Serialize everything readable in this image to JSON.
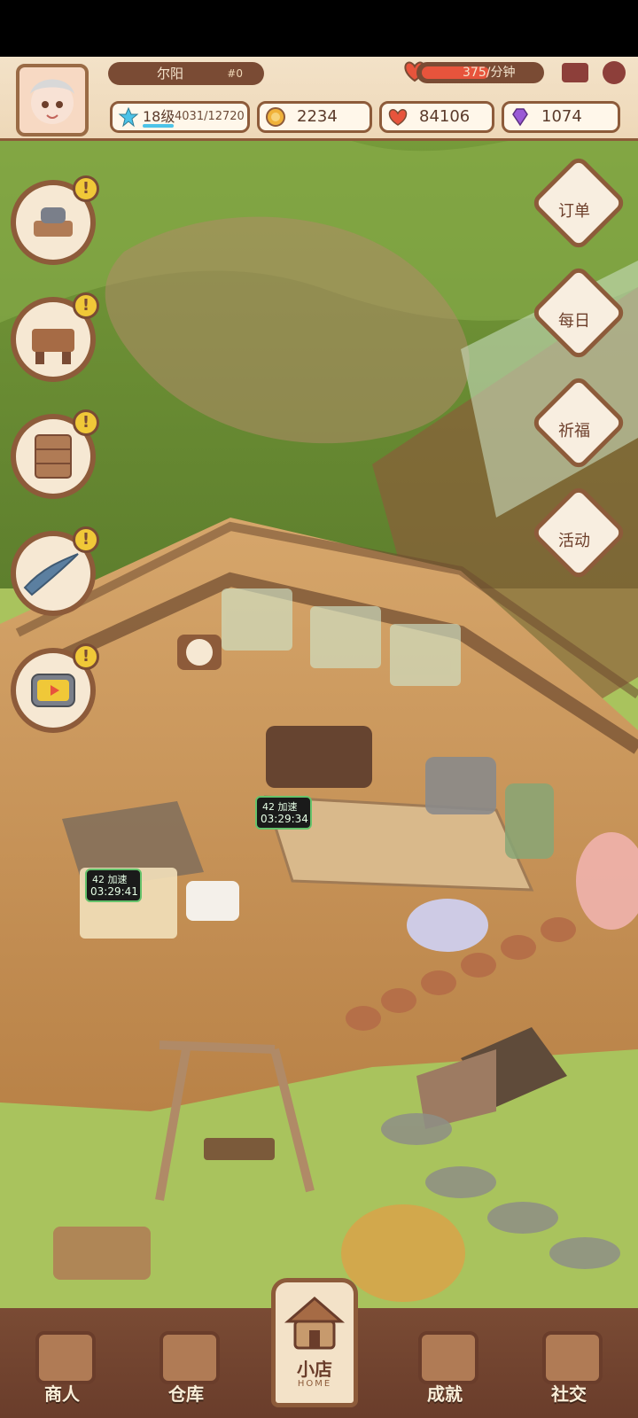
{
  "header": {
    "player_name": "尔阳",
    "player_rank": "#0",
    "income_rate": "375/分钟",
    "icons": {
      "mail": "mail-icon",
      "settings": "gear-icon",
      "avatar": "avatar"
    }
  },
  "stats": {
    "level": {
      "label": "18级",
      "exp": "4031/12720",
      "progress": 0.32
    },
    "coins": "2234",
    "hearts": "84106",
    "gems": "1074"
  },
  "left_actions": [
    {
      "name": "cooking-station",
      "alert": "!"
    },
    {
      "name": "desk",
      "alert": "!"
    },
    {
      "name": "cabinet",
      "alert": "!"
    },
    {
      "name": "fish",
      "alert": "!"
    },
    {
      "name": "tv-video",
      "alert": "!"
    }
  ],
  "right_actions": [
    {
      "label": "订单",
      "icon": "order-icon"
    },
    {
      "label": "每日",
      "icon": "daily-icon"
    },
    {
      "label": "祈福",
      "icon": "pray-icon"
    },
    {
      "label": "活动",
      "icon": "event-icon"
    }
  ],
  "timers": [
    {
      "level": "42",
      "action": "加速",
      "time": "03:29:34"
    },
    {
      "level": "42",
      "action": "加速",
      "time": "03:29:41"
    }
  ],
  "bottom_nav": {
    "merchant": "商人",
    "warehouse": "仓库",
    "home": "小店",
    "home_sub": "HOME",
    "achievements": "成就",
    "social": "社交"
  },
  "colors": {
    "accent_brown": "#8d5b3a",
    "parchment": "#f3e2c8",
    "alert_yellow": "#f0c838",
    "health_red": "#e7543c"
  }
}
